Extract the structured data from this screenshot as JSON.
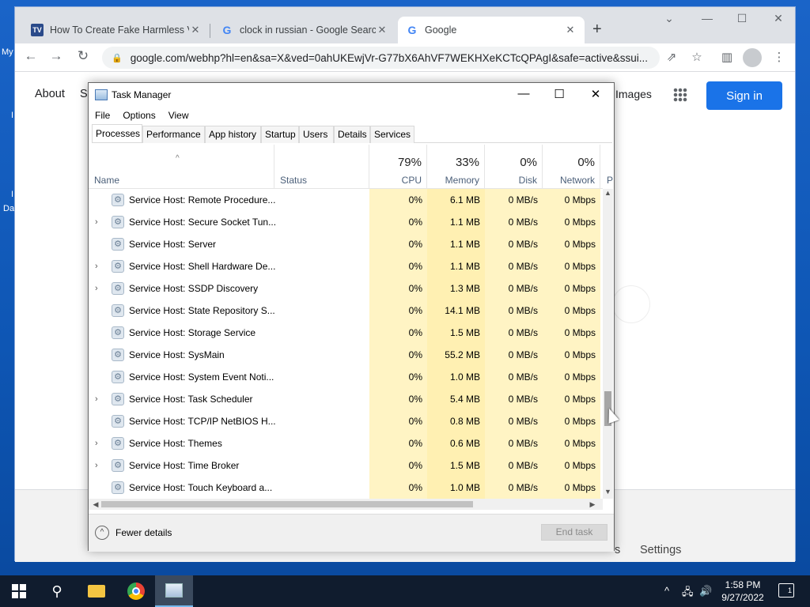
{
  "desktop": {
    "labels": [
      "My",
      "I",
      "I",
      "Da"
    ]
  },
  "browser": {
    "tabs": [
      {
        "title": "How To Create Fake Harmless Vi",
        "favicon": "tv-icon"
      },
      {
        "title": "clock in russian - Google Search",
        "favicon": "google-icon"
      },
      {
        "title": "Google",
        "favicon": "google-icon",
        "active": true
      }
    ],
    "new_tab": "+",
    "url": "google.com/webhp?hl=en&sa=X&ved=0ahUKEwjVr-G77bX6AhVF7WEKHXeKCTcQPAgI&safe=active&ssui...",
    "page": {
      "about": "About",
      "store_partial": "St",
      "images": "Images",
      "sign_in": "Sign in",
      "footer_partial": "s",
      "settings": "Settings"
    }
  },
  "task_manager": {
    "title": "Task Manager",
    "menu": [
      "File",
      "Options",
      "View"
    ],
    "tabs": [
      "Processes",
      "Performance",
      "App history",
      "Startup",
      "Users",
      "Details",
      "Services"
    ],
    "active_tab": "Processes",
    "columns": {
      "name": "Name",
      "status": "Status",
      "cpu": {
        "pct": "79%",
        "label": "CPU"
      },
      "memory": {
        "pct": "33%",
        "label": "Memory"
      },
      "disk": {
        "pct": "0%",
        "label": "Disk"
      },
      "network": {
        "pct": "0%",
        "label": "Network"
      },
      "power_partial": "P"
    },
    "rows": [
      {
        "expandable": false,
        "name": "Service Host: Remote Procedure...",
        "cpu": "0%",
        "memory": "6.1 MB",
        "disk": "0 MB/s",
        "network": "0 Mbps"
      },
      {
        "expandable": true,
        "name": "Service Host: Secure Socket Tun...",
        "cpu": "0%",
        "memory": "1.1 MB",
        "disk": "0 MB/s",
        "network": "0 Mbps"
      },
      {
        "expandable": false,
        "name": "Service Host: Server",
        "cpu": "0%",
        "memory": "1.1 MB",
        "disk": "0 MB/s",
        "network": "0 Mbps"
      },
      {
        "expandable": true,
        "name": "Service Host: Shell Hardware De...",
        "cpu": "0%",
        "memory": "1.1 MB",
        "disk": "0 MB/s",
        "network": "0 Mbps"
      },
      {
        "expandable": true,
        "name": "Service Host: SSDP Discovery",
        "cpu": "0%",
        "memory": "1.3 MB",
        "disk": "0 MB/s",
        "network": "0 Mbps"
      },
      {
        "expandable": false,
        "name": "Service Host: State Repository S...",
        "cpu": "0%",
        "memory": "14.1 MB",
        "disk": "0 MB/s",
        "network": "0 Mbps"
      },
      {
        "expandable": false,
        "name": "Service Host: Storage Service",
        "cpu": "0%",
        "memory": "1.5 MB",
        "disk": "0 MB/s",
        "network": "0 Mbps"
      },
      {
        "expandable": false,
        "name": "Service Host: SysMain",
        "cpu": "0%",
        "memory": "55.2 MB",
        "disk": "0 MB/s",
        "network": "0 Mbps"
      },
      {
        "expandable": false,
        "name": "Service Host: System Event Noti...",
        "cpu": "0%",
        "memory": "1.0 MB",
        "disk": "0 MB/s",
        "network": "0 Mbps"
      },
      {
        "expandable": true,
        "name": "Service Host: Task Scheduler",
        "cpu": "0%",
        "memory": "5.4 MB",
        "disk": "0 MB/s",
        "network": "0 Mbps"
      },
      {
        "expandable": false,
        "name": "Service Host: TCP/IP NetBIOS H...",
        "cpu": "0%",
        "memory": "0.8 MB",
        "disk": "0 MB/s",
        "network": "0 Mbps"
      },
      {
        "expandable": true,
        "name": "Service Host: Themes",
        "cpu": "0%",
        "memory": "0.6 MB",
        "disk": "0 MB/s",
        "network": "0 Mbps"
      },
      {
        "expandable": true,
        "name": "Service Host: Time Broker",
        "cpu": "0%",
        "memory": "1.5 MB",
        "disk": "0 MB/s",
        "network": "0 Mbps"
      },
      {
        "expandable": false,
        "name": "Service Host: Touch Keyboard a...",
        "cpu": "0%",
        "memory": "1.0 MB",
        "disk": "0 MB/s",
        "network": "0 Mbps"
      }
    ],
    "footer": {
      "fewer_details": "Fewer details",
      "end_task": "End task"
    }
  },
  "taskbar": {
    "time": "1:58 PM",
    "date": "9/27/2022",
    "notification_count": "1",
    "icons": [
      "start-icon",
      "search-icon",
      "file-explorer-icon",
      "chrome-icon",
      "task-manager-icon"
    ]
  }
}
